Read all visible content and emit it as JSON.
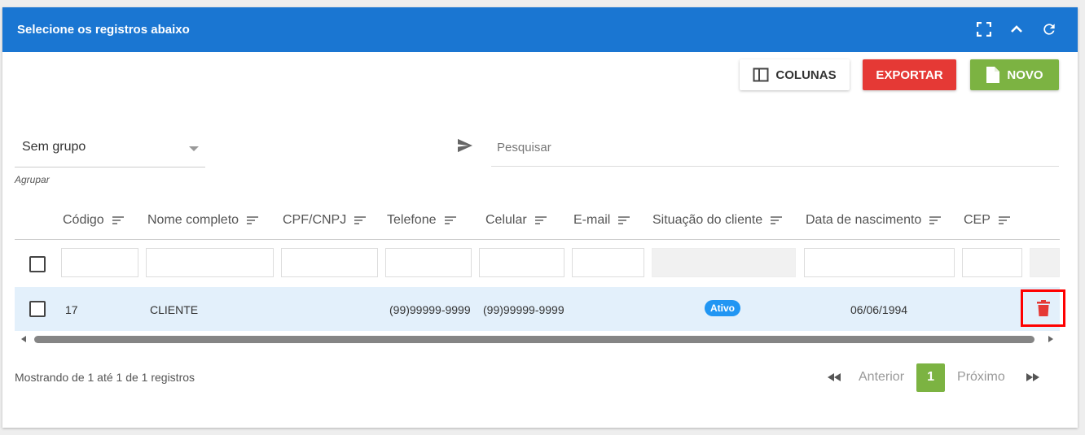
{
  "header": {
    "title": "Selecione os registros abaixo",
    "icons": [
      "fullscreen-icon",
      "collapse-icon",
      "refresh-icon"
    ]
  },
  "toolbar": {
    "columns_label": "COLUNAS",
    "export_label": "EXPORTAR",
    "new_label": "NOVO"
  },
  "group": {
    "value": "Sem grupo",
    "label": "Agrupar"
  },
  "search": {
    "placeholder": "Pesquisar"
  },
  "table": {
    "columns": [
      "Código",
      "Nome completo",
      "CPF/CNPJ",
      "Telefone",
      "Celular",
      "E-mail",
      "Situação do cliente",
      "Data de nascimento",
      "CEP"
    ],
    "rows": [
      {
        "codigo": "17",
        "nome": "CLIENTE",
        "cpf": "",
        "telefone": "(99)99999-9999",
        "celular": "(99)99999-9999",
        "email": "",
        "situacao": "Ativo",
        "nascimento": "06/06/1994",
        "cep": ""
      }
    ]
  },
  "footer": {
    "info": "Mostrando de 1 até 1 de 1 registros",
    "prev": "Anterior",
    "page": "1",
    "next": "Próximo"
  },
  "colors": {
    "header": "#1a76d2",
    "export": "#e53935",
    "new": "#7cb342",
    "badge": "#2196f3",
    "delete": "#e53935",
    "row_highlight": "#e3f0fb"
  }
}
